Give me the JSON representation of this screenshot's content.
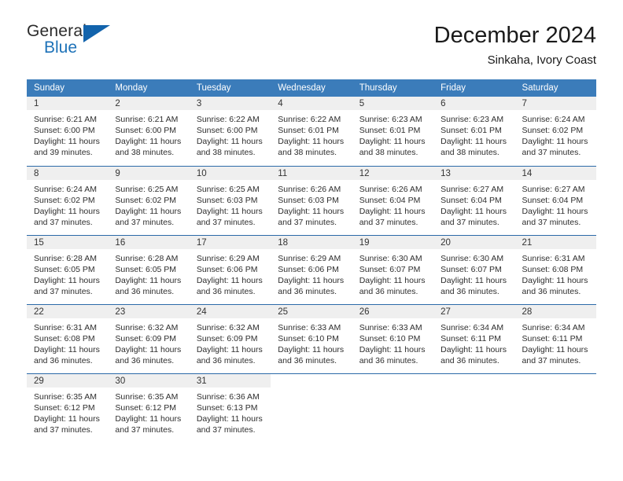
{
  "brand": {
    "word_general": "General",
    "word_blue": "Blue",
    "triangle_icon": "triangle-icon"
  },
  "header": {
    "title": "December 2024",
    "subtitle": "Sinkaha, Ivory Coast"
  },
  "calendar": {
    "weekday_headers": [
      "Sunday",
      "Monday",
      "Tuesday",
      "Wednesday",
      "Thursday",
      "Friday",
      "Saturday"
    ],
    "colors": {
      "header_blue": "#3b7cba",
      "rule_blue": "#2c6aa8",
      "daynum_band": "#efefef",
      "brand_blue": "#1d72b8"
    },
    "weeks": [
      [
        {
          "day": "1",
          "sunrise": "Sunrise: 6:21 AM",
          "sunset": "Sunset: 6:00 PM",
          "daylight1": "Daylight: 11 hours",
          "daylight2": "and 39 minutes."
        },
        {
          "day": "2",
          "sunrise": "Sunrise: 6:21 AM",
          "sunset": "Sunset: 6:00 PM",
          "daylight1": "Daylight: 11 hours",
          "daylight2": "and 38 minutes."
        },
        {
          "day": "3",
          "sunrise": "Sunrise: 6:22 AM",
          "sunset": "Sunset: 6:00 PM",
          "daylight1": "Daylight: 11 hours",
          "daylight2": "and 38 minutes."
        },
        {
          "day": "4",
          "sunrise": "Sunrise: 6:22 AM",
          "sunset": "Sunset: 6:01 PM",
          "daylight1": "Daylight: 11 hours",
          "daylight2": "and 38 minutes."
        },
        {
          "day": "5",
          "sunrise": "Sunrise: 6:23 AM",
          "sunset": "Sunset: 6:01 PM",
          "daylight1": "Daylight: 11 hours",
          "daylight2": "and 38 minutes."
        },
        {
          "day": "6",
          "sunrise": "Sunrise: 6:23 AM",
          "sunset": "Sunset: 6:01 PM",
          "daylight1": "Daylight: 11 hours",
          "daylight2": "and 38 minutes."
        },
        {
          "day": "7",
          "sunrise": "Sunrise: 6:24 AM",
          "sunset": "Sunset: 6:02 PM",
          "daylight1": "Daylight: 11 hours",
          "daylight2": "and 37 minutes."
        }
      ],
      [
        {
          "day": "8",
          "sunrise": "Sunrise: 6:24 AM",
          "sunset": "Sunset: 6:02 PM",
          "daylight1": "Daylight: 11 hours",
          "daylight2": "and 37 minutes."
        },
        {
          "day": "9",
          "sunrise": "Sunrise: 6:25 AM",
          "sunset": "Sunset: 6:02 PM",
          "daylight1": "Daylight: 11 hours",
          "daylight2": "and 37 minutes."
        },
        {
          "day": "10",
          "sunrise": "Sunrise: 6:25 AM",
          "sunset": "Sunset: 6:03 PM",
          "daylight1": "Daylight: 11 hours",
          "daylight2": "and 37 minutes."
        },
        {
          "day": "11",
          "sunrise": "Sunrise: 6:26 AM",
          "sunset": "Sunset: 6:03 PM",
          "daylight1": "Daylight: 11 hours",
          "daylight2": "and 37 minutes."
        },
        {
          "day": "12",
          "sunrise": "Sunrise: 6:26 AM",
          "sunset": "Sunset: 6:04 PM",
          "daylight1": "Daylight: 11 hours",
          "daylight2": "and 37 minutes."
        },
        {
          "day": "13",
          "sunrise": "Sunrise: 6:27 AM",
          "sunset": "Sunset: 6:04 PM",
          "daylight1": "Daylight: 11 hours",
          "daylight2": "and 37 minutes."
        },
        {
          "day": "14",
          "sunrise": "Sunrise: 6:27 AM",
          "sunset": "Sunset: 6:04 PM",
          "daylight1": "Daylight: 11 hours",
          "daylight2": "and 37 minutes."
        }
      ],
      [
        {
          "day": "15",
          "sunrise": "Sunrise: 6:28 AM",
          "sunset": "Sunset: 6:05 PM",
          "daylight1": "Daylight: 11 hours",
          "daylight2": "and 37 minutes."
        },
        {
          "day": "16",
          "sunrise": "Sunrise: 6:28 AM",
          "sunset": "Sunset: 6:05 PM",
          "daylight1": "Daylight: 11 hours",
          "daylight2": "and 36 minutes."
        },
        {
          "day": "17",
          "sunrise": "Sunrise: 6:29 AM",
          "sunset": "Sunset: 6:06 PM",
          "daylight1": "Daylight: 11 hours",
          "daylight2": "and 36 minutes."
        },
        {
          "day": "18",
          "sunrise": "Sunrise: 6:29 AM",
          "sunset": "Sunset: 6:06 PM",
          "daylight1": "Daylight: 11 hours",
          "daylight2": "and 36 minutes."
        },
        {
          "day": "19",
          "sunrise": "Sunrise: 6:30 AM",
          "sunset": "Sunset: 6:07 PM",
          "daylight1": "Daylight: 11 hours",
          "daylight2": "and 36 minutes."
        },
        {
          "day": "20",
          "sunrise": "Sunrise: 6:30 AM",
          "sunset": "Sunset: 6:07 PM",
          "daylight1": "Daylight: 11 hours",
          "daylight2": "and 36 minutes."
        },
        {
          "day": "21",
          "sunrise": "Sunrise: 6:31 AM",
          "sunset": "Sunset: 6:08 PM",
          "daylight1": "Daylight: 11 hours",
          "daylight2": "and 36 minutes."
        }
      ],
      [
        {
          "day": "22",
          "sunrise": "Sunrise: 6:31 AM",
          "sunset": "Sunset: 6:08 PM",
          "daylight1": "Daylight: 11 hours",
          "daylight2": "and 36 minutes."
        },
        {
          "day": "23",
          "sunrise": "Sunrise: 6:32 AM",
          "sunset": "Sunset: 6:09 PM",
          "daylight1": "Daylight: 11 hours",
          "daylight2": "and 36 minutes."
        },
        {
          "day": "24",
          "sunrise": "Sunrise: 6:32 AM",
          "sunset": "Sunset: 6:09 PM",
          "daylight1": "Daylight: 11 hours",
          "daylight2": "and 36 minutes."
        },
        {
          "day": "25",
          "sunrise": "Sunrise: 6:33 AM",
          "sunset": "Sunset: 6:10 PM",
          "daylight1": "Daylight: 11 hours",
          "daylight2": "and 36 minutes."
        },
        {
          "day": "26",
          "sunrise": "Sunrise: 6:33 AM",
          "sunset": "Sunset: 6:10 PM",
          "daylight1": "Daylight: 11 hours",
          "daylight2": "and 36 minutes."
        },
        {
          "day": "27",
          "sunrise": "Sunrise: 6:34 AM",
          "sunset": "Sunset: 6:11 PM",
          "daylight1": "Daylight: 11 hours",
          "daylight2": "and 36 minutes."
        },
        {
          "day": "28",
          "sunrise": "Sunrise: 6:34 AM",
          "sunset": "Sunset: 6:11 PM",
          "daylight1": "Daylight: 11 hours",
          "daylight2": "and 37 minutes."
        }
      ],
      [
        {
          "day": "29",
          "sunrise": "Sunrise: 6:35 AM",
          "sunset": "Sunset: 6:12 PM",
          "daylight1": "Daylight: 11 hours",
          "daylight2": "and 37 minutes."
        },
        {
          "day": "30",
          "sunrise": "Sunrise: 6:35 AM",
          "sunset": "Sunset: 6:12 PM",
          "daylight1": "Daylight: 11 hours",
          "daylight2": "and 37 minutes."
        },
        {
          "day": "31",
          "sunrise": "Sunrise: 6:36 AM",
          "sunset": "Sunset: 6:13 PM",
          "daylight1": "Daylight: 11 hours",
          "daylight2": "and 37 minutes."
        },
        {
          "day": "",
          "sunrise": "",
          "sunset": "",
          "daylight1": "",
          "daylight2": ""
        },
        {
          "day": "",
          "sunrise": "",
          "sunset": "",
          "daylight1": "",
          "daylight2": ""
        },
        {
          "day": "",
          "sunrise": "",
          "sunset": "",
          "daylight1": "",
          "daylight2": ""
        },
        {
          "day": "",
          "sunrise": "",
          "sunset": "",
          "daylight1": "",
          "daylight2": ""
        }
      ]
    ]
  }
}
